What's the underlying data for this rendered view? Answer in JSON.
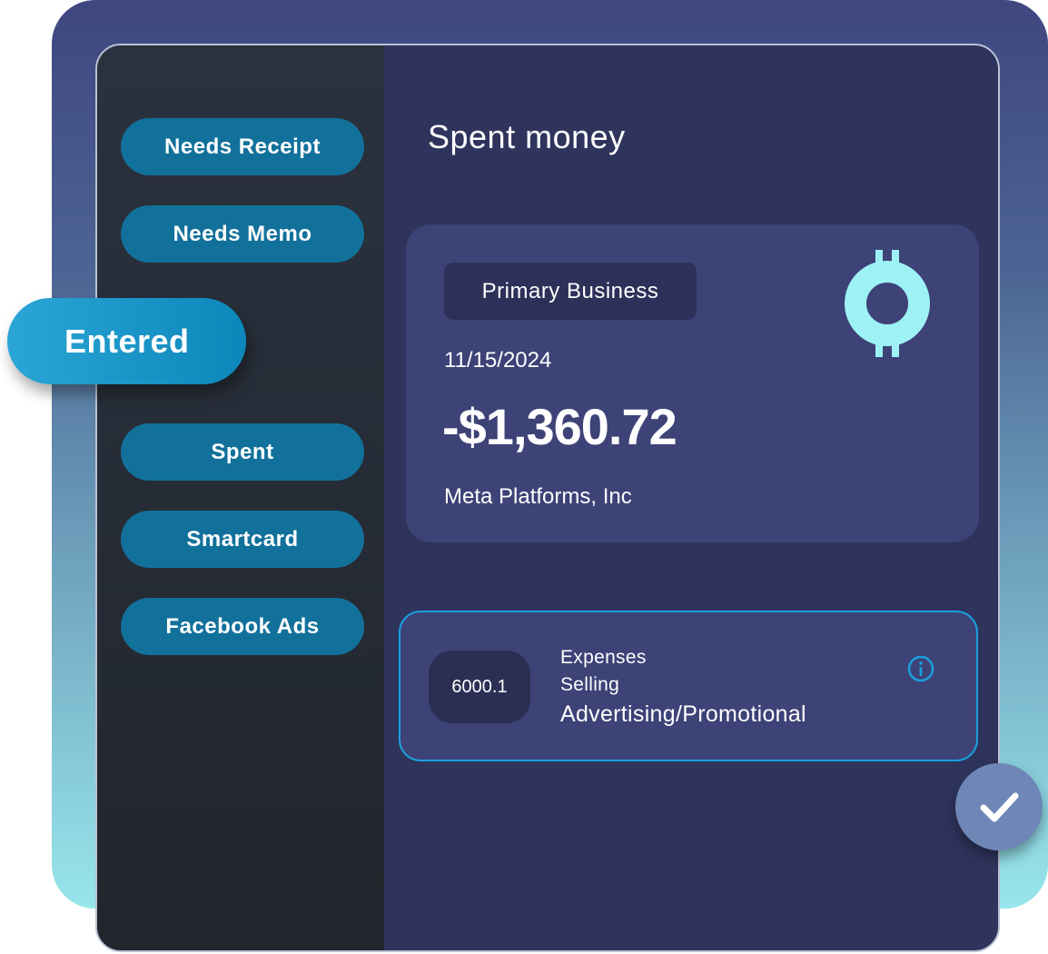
{
  "sidebar": {
    "filters": [
      {
        "label": "Needs Receipt"
      },
      {
        "label": "Needs Memo"
      },
      {
        "label": "Spent"
      },
      {
        "label": "Smartcard"
      },
      {
        "label": "Facebook Ads"
      }
    ],
    "active_filter": "Entered"
  },
  "main": {
    "title": "Spent money",
    "transaction": {
      "tag": "Primary Business",
      "date": "11/15/2024",
      "amount": "-$1,360.72",
      "payee": "Meta Platforms, Inc",
      "icon": "currency-icon"
    },
    "account": {
      "code": "6000.1",
      "category": "Expenses",
      "subcategory": "Selling",
      "name": "Advertising/Promotional",
      "icon": "info-icon"
    }
  },
  "actions": {
    "confirm_icon": "checkmark-icon"
  },
  "colors": {
    "accent": "#1b9fdc",
    "pill": "#12719b",
    "icon_cyan": "#9ef2f6",
    "card": "#3d4277",
    "panel": "#2f345d"
  }
}
